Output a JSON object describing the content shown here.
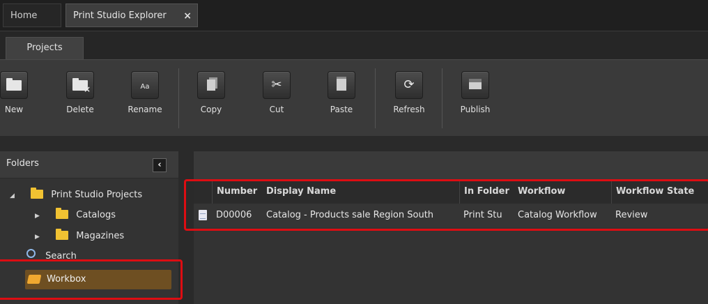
{
  "window_tabs": [
    {
      "label": "Home"
    },
    {
      "label": "Print Studio Explorer",
      "close_icon": "×"
    }
  ],
  "ribbon_tab": {
    "label": "Projects"
  },
  "toolbar": {
    "new": "New",
    "delete": "Delete",
    "rename": "Rename",
    "copy": "Copy",
    "cut": "Cut",
    "paste": "Paste",
    "refresh": "Refresh",
    "publish": "Publish"
  },
  "icons": {
    "rename_glyph": "Aa",
    "cut_glyph": "✂",
    "refresh_glyph": "⟳",
    "collapse_glyph": "‹"
  },
  "folders": {
    "title": "Folders",
    "items": [
      {
        "label": "Print Studio Projects",
        "expanded": true
      },
      {
        "label": "Catalogs",
        "expanded": false
      },
      {
        "label": "Magazines",
        "expanded": false
      },
      {
        "label": "Search"
      },
      {
        "label": "Workbox",
        "selected": true
      }
    ]
  },
  "grid": {
    "columns": [
      "Number",
      "Display Name",
      "In Folder",
      "Workflow",
      "Workflow State"
    ],
    "rows": [
      {
        "number": "D00006",
        "display_name": "Catalog - Products sale Region South",
        "in_folder": "Print Stu",
        "workflow": "Catalog Workflow",
        "state": "Review"
      }
    ]
  },
  "colors": {
    "highlight": "#dd0d12",
    "selected_item": "#6e4f22",
    "folder_icon": "#f1c232"
  }
}
